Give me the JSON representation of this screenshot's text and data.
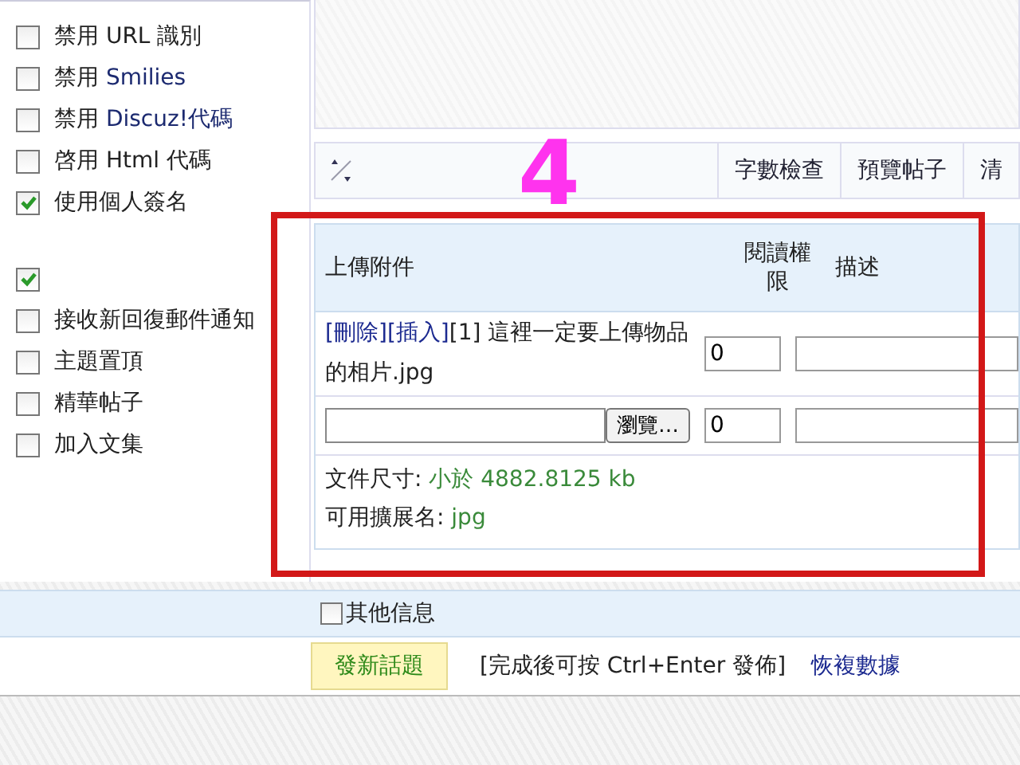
{
  "options": [
    {
      "label": "禁用 URL 識別",
      "checked": false
    },
    {
      "label": "禁用 ",
      "term": "Smilies",
      "checked": false
    },
    {
      "label": "禁用 ",
      "term": "Discuz!代碼",
      "checked": false
    },
    {
      "label": "啓用 Html 代碼",
      "checked": false
    },
    {
      "label": "使用個人簽名",
      "checked": true
    },
    {
      "checked": true
    },
    {
      "label": "接收新回復郵件通知",
      "checked": false
    },
    {
      "label": "主題置頂",
      "checked": false
    },
    {
      "label": "精華帖子",
      "checked": false
    },
    {
      "label": "加入文集",
      "checked": false
    }
  ],
  "toolbar": {
    "buttons": [
      "字數檢查",
      "預覽帖子",
      "清"
    ]
  },
  "annotation": {
    "number": "4"
  },
  "upload": {
    "columns": [
      "上傳附件",
      "閱讀權限",
      "描述"
    ],
    "attachment": {
      "actions": [
        "[刪除]",
        "[插入]"
      ],
      "text": "[1] 這裡一定要上傳物品的相片.jpg",
      "permission": "0"
    },
    "new_file": {
      "browse": "瀏覽…",
      "permission": "0"
    },
    "size_label": "文件尺寸:",
    "size_value": "小於 4882.8125 kb",
    "ext_label": "可用擴展名:",
    "ext_value": "jpg"
  },
  "other_info": {
    "label": "其他信息",
    "checked": false
  },
  "submit": {
    "button": "發新話題",
    "hint": "[完成後可按 Ctrl+Enter 發佈]",
    "restore": "恢複數據"
  }
}
